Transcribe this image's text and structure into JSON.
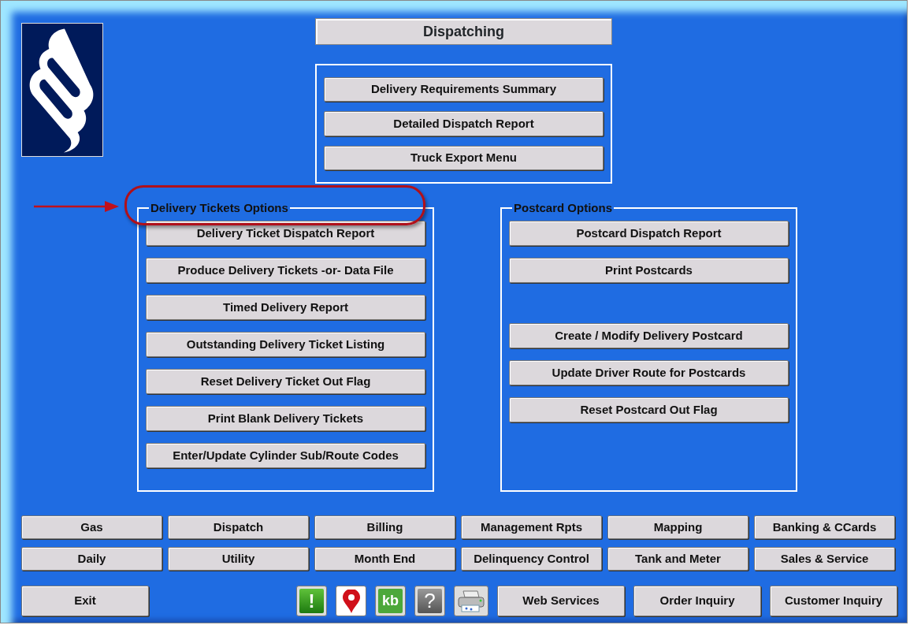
{
  "title": "Dispatching",
  "top_buttons": [
    "Delivery Requirements Summary",
    "Detailed Dispatch Report",
    "Truck Export Menu"
  ],
  "groups": [
    {
      "legend": "Delivery Tickets Options",
      "highlighted": true,
      "sections": [
        [
          "Delivery Ticket Dispatch Report",
          "Produce Delivery Tickets -or- Data File",
          "Timed Delivery Report",
          "Outstanding Delivery Ticket Listing",
          "Reset Delivery Ticket Out Flag",
          "Print Blank Delivery Tickets",
          "Enter/Update Cylinder Sub/Route Codes"
        ]
      ]
    },
    {
      "legend": "Postcard Options",
      "highlighted": false,
      "sections": [
        [
          "Postcard Dispatch Report",
          "Print Postcards"
        ],
        [
          "Create / Modify Delivery Postcard",
          "Update Driver Route for Postcards",
          "Reset Postcard Out Flag"
        ]
      ]
    }
  ],
  "nav_buttons": [
    "Gas",
    "Dispatch",
    "Billing",
    "Management Rpts",
    "Mapping",
    "Banking & CCards",
    "Daily",
    "Utility",
    "Month End",
    "Delinquency Control",
    "Tank and Meter",
    "Sales & Service"
  ],
  "exit_button": "Exit",
  "tool_icons": [
    {
      "kind": "alert",
      "label": "!"
    },
    {
      "kind": "pin"
    },
    {
      "kind": "kb",
      "label": "kb"
    },
    {
      "kind": "help",
      "label": "?"
    },
    {
      "kind": "printer"
    }
  ],
  "action_buttons": [
    "Web Services",
    "Order Inquiry",
    "Customer Inquiry"
  ]
}
